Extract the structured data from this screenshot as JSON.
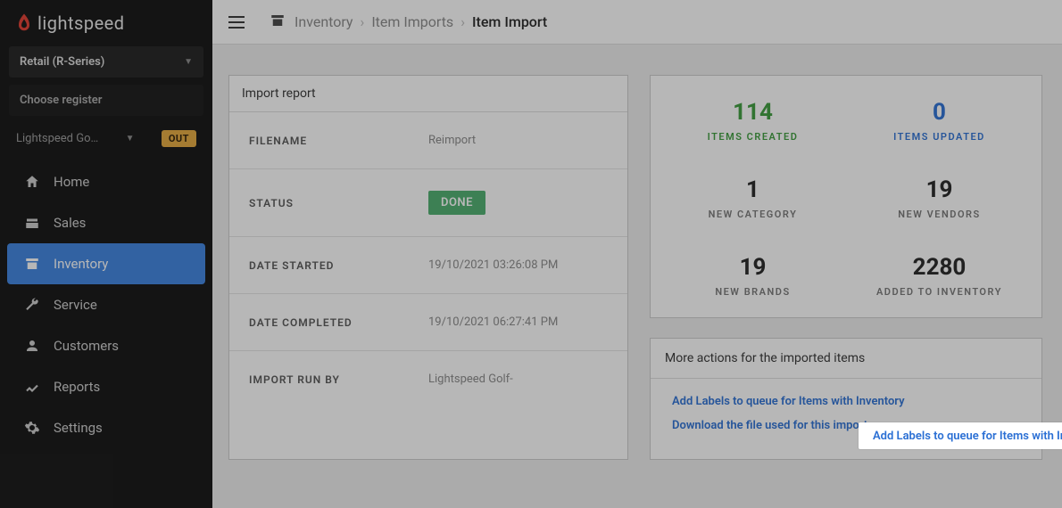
{
  "brand": "lightspeed",
  "product_selector": "Retail (R-Series)",
  "choose_register": "Choose register",
  "store_name": "Lightspeed Go…",
  "out_label": "OUT",
  "nav": {
    "home": "Home",
    "sales": "Sales",
    "inventory": "Inventory",
    "service": "Service",
    "customers": "Customers",
    "reports": "Reports",
    "settings": "Settings"
  },
  "breadcrumbs": {
    "a": "Inventory",
    "b": "Item Imports",
    "c": "Item Import"
  },
  "report": {
    "title": "Import report",
    "filename_key": "FILENAME",
    "filename_val": "Reimport",
    "status_key": "STATUS",
    "status_val": "DONE",
    "date_started_key": "DATE STARTED",
    "date_started_val": "19/10/2021 03:26:08 PM",
    "date_completed_key": "DATE COMPLETED",
    "date_completed_val": "19/10/2021 06:27:41 PM",
    "run_by_key": "IMPORT RUN BY",
    "run_by_val": "Lightspeed Golf-"
  },
  "stats": {
    "items_created_num": "114",
    "items_created_label": "ITEMS CREATED",
    "items_updated_num": "0",
    "items_updated_label": "ITEMS UPDATED",
    "new_category_num": "1",
    "new_category_label": "NEW CATEGORY",
    "new_vendors_num": "19",
    "new_vendors_label": "NEW VENDORS",
    "new_brands_num": "19",
    "new_brands_label": "NEW BRANDS",
    "inventory_num": "2280",
    "inventory_label": "ADDED TO INVENTORY"
  },
  "actions": {
    "title": "More actions for the imported items",
    "add_labels": "Add Labels to queue for Items with Inventory",
    "download": "Download the file used for this import"
  }
}
